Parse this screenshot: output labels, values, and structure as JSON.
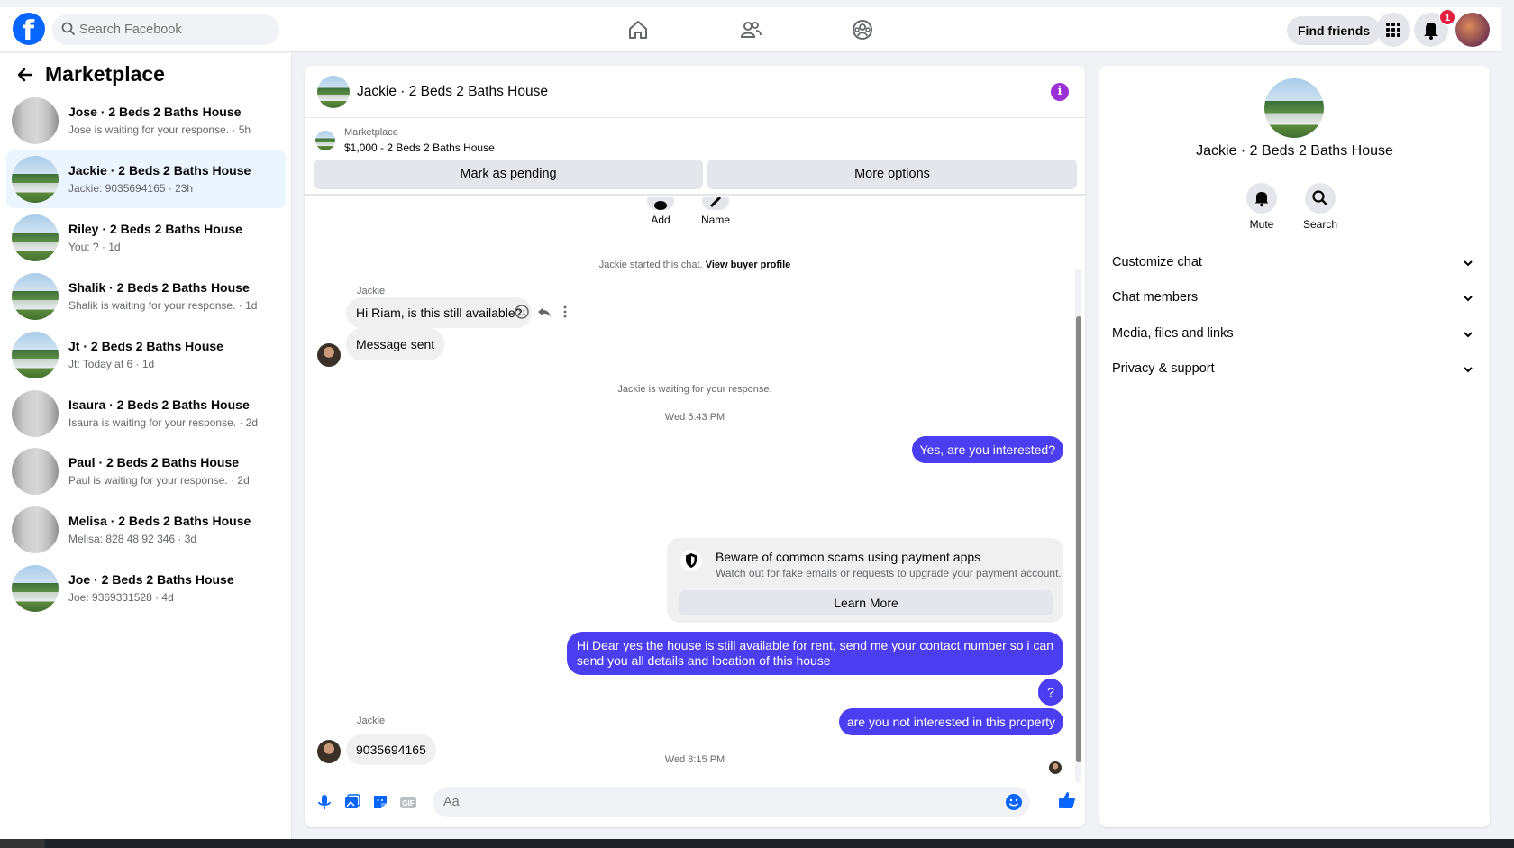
{
  "topbar": {
    "search_placeholder": "Search Facebook",
    "find_friends_label": "Find friends",
    "notification_count": "1",
    "icons": [
      "facebook-logo",
      "home-icon",
      "friends-icon",
      "groups-icon",
      "menu-grid-icon",
      "bell-icon",
      "profile-avatar"
    ]
  },
  "sidebar": {
    "title": "Marketplace",
    "conversations": [
      {
        "name": "Jose · 2 Beds 2 Baths House",
        "preview": "Jose is waiting for your response. · 5h",
        "thumb": "room"
      },
      {
        "name": "Jackie · 2 Beds 2 Baths House",
        "preview": "Jackie: 9035694165 · 23h",
        "thumb": "house",
        "active": true
      },
      {
        "name": "Riley · 2 Beds 2 Baths House",
        "preview": "You: ? · 1d",
        "thumb": "house"
      },
      {
        "name": "Shalik · 2 Beds 2 Baths House",
        "preview": "Shalik is waiting for your response. · 1d",
        "thumb": "house"
      },
      {
        "name": "Jt · 2 Beds 2 Baths House",
        "preview": "Jt: Today at 6 · 1d",
        "thumb": "house"
      },
      {
        "name": "Isaura · 2 Beds 2 Baths House",
        "preview": "Isaura is waiting for your response. · 2d",
        "thumb": "room"
      },
      {
        "name": "Paul · 2 Beds 2 Baths House",
        "preview": "Paul is waiting for your response. · 2d",
        "thumb": "room"
      },
      {
        "name": "Melisa · 2 Beds 2 Baths House",
        "preview": "Melisa: 828 48 92 346 · 3d",
        "thumb": "room"
      },
      {
        "name": "Joe · 2 Beds 2 Baths House",
        "preview": "Joe: 9369331528 · 4d",
        "thumb": "house"
      }
    ]
  },
  "chat": {
    "title": "Jackie · 2 Beds 2 Baths House",
    "listing_source": "Marketplace",
    "listing_price": "$1,000 - 2 Beds 2 Baths House",
    "mark_pending_label": "Mark as pending",
    "more_options_label": "More options",
    "add_label": "Add",
    "name_label": "Name",
    "started_text": "Jackie started this chat.",
    "view_profile_label": "View buyer profile",
    "sender_1": "Jackie",
    "msg_1": "Hi Riam, is this still available?",
    "msg_2": "Message sent",
    "waiting_text": "Jackie is waiting for your response.",
    "time_1": "Wed 5:43 PM",
    "out_1": "Yes, are you interested?",
    "scam_title": "Beware of common scams using payment apps",
    "scam_subtitle": "Watch out for fake emails or requests to upgrade your payment account.",
    "learn_more_label": "Learn More",
    "out_2_line1": "Hi Dear yes the house is still available for rent, send me your contact number so i can",
    "out_2_line2": "send you all details and location of this house",
    "out_3": "?",
    "out_4": "are you not interested in this property",
    "time_2": "Wed 8:15 PM",
    "sender_2": "Jackie",
    "msg_3": "9035694165",
    "composer_placeholder": "Aa",
    "accent_color": "#4a3ef0"
  },
  "info_panel": {
    "title": "Jackie · 2 Beds 2 Baths House",
    "mute_label": "Mute",
    "search_label": "Search",
    "sections": [
      "Customize chat",
      "Chat members",
      "Media, files and links",
      "Privacy & support"
    ]
  }
}
